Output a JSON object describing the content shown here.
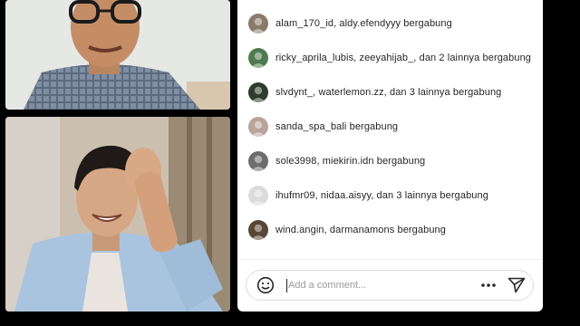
{
  "comments_panel": {
    "join_events": [
      {
        "text": "alam_170_id, aldy.efendyyy bergabung",
        "avatar_color": "#8a7a6a"
      },
      {
        "text": "ricky_aprila_lubis, zeeyahijab_, dan 2 lainnya bergabung",
        "avatar_color": "#4e7a4e"
      },
      {
        "text": "slvdynt_, waterlemon.zz, dan 3 lainnya bergabung",
        "avatar_color": "#2e3b2e"
      },
      {
        "text": "sanda_spa_bali bergabung",
        "avatar_color": "#b9a39a"
      },
      {
        "text": "sole3998, miekirin.idn bergabung",
        "avatar_color": "#6d6d6d"
      },
      {
        "text": "ihufmr09, nidaa.aisyy, dan 3 lainnya bergabung",
        "avatar_color": "#dbdbdb"
      },
      {
        "text": "wind.angin, darmanamons bergabung",
        "avatar_color": "#5a4636"
      }
    ],
    "comment_input": {
      "placeholder": "Add a comment..."
    },
    "icons": {
      "emoji": "smiley-icon",
      "more": "more-options-icon",
      "send": "send-icon"
    }
  },
  "colors": {
    "panel_bg": "#ffffff",
    "text": "#262626",
    "placeholder": "#9a9a9a",
    "page_bg": "#000000"
  }
}
